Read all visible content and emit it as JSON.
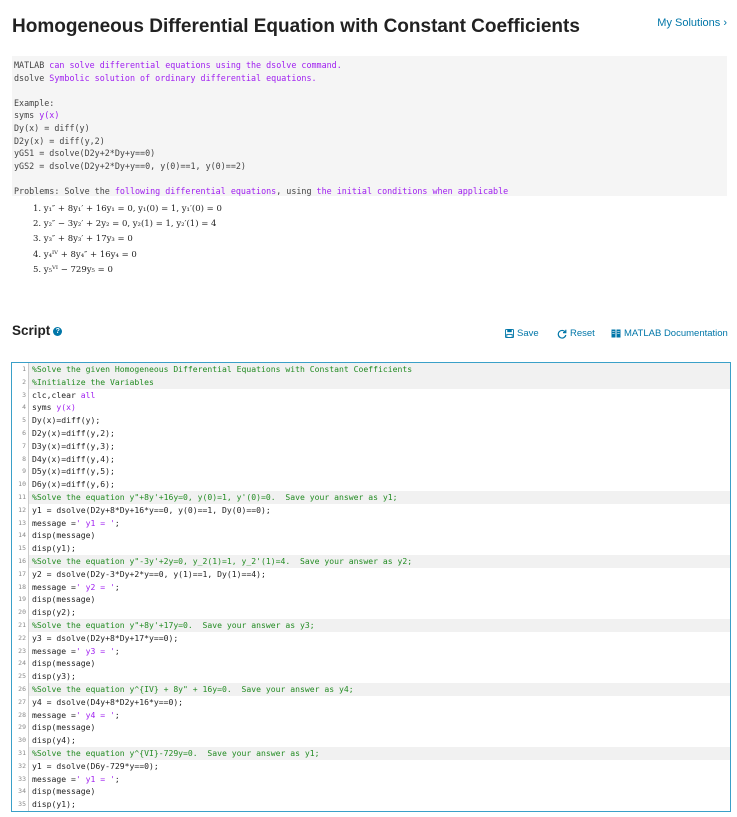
{
  "header": {
    "title": "Homogeneous Differential Equation with Constant Coefficients",
    "my_solutions": "My Solutions ›"
  },
  "description": {
    "lines": [
      [
        {
          "t": "MATLAB ",
          "c": ""
        },
        {
          "t": "can solve differential equations using the dsolve command.",
          "c": "purple"
        }
      ],
      [
        {
          "t": "dsolve ",
          "c": ""
        },
        {
          "t": "Symbolic solution of ordinary differential equations.",
          "c": "purple"
        }
      ],
      [],
      [
        {
          "t": "Example:",
          "c": ""
        }
      ],
      [
        {
          "t": "syms ",
          "c": ""
        },
        {
          "t": "y(x)",
          "c": "purple"
        }
      ],
      [
        {
          "t": "Dy(x) = diff(y)",
          "c": ""
        }
      ],
      [
        {
          "t": "D2y(x) = diff(y,2)",
          "c": ""
        }
      ],
      [
        {
          "t": "yGS1 = dsolve(D2y+2*Dy+y==0)",
          "c": ""
        }
      ],
      [
        {
          "t": "yGS2 = dsolve(D2y+2*Dy+y==0, y(0)==1, y(0)==2)",
          "c": ""
        }
      ],
      [],
      [
        {
          "t": "Problems: Solve the ",
          "c": ""
        },
        {
          "t": "following differential equations",
          "c": "purple"
        },
        {
          "t": ", using ",
          "c": ""
        },
        {
          "t": "the initial conditions when applicable",
          "c": "purple"
        }
      ]
    ]
  },
  "problems": [
    "1. y₁″ + 8y₁′ + 16y₁ = 0, y₁(0) = 1, y₁′(0) = 0",
    "2. y₂″ − 3y₂′ + 2y₂ = 0, y₂(1) = 1, y₂′(1) = 4",
    "3. y₃″ + 8y₃′ + 17y₃ = 0",
    "4. y₄ᴵⱽ + 8y₄″ + 16y₄ = 0",
    "5. y₅ⱽᴵ − 729y₅ = 0"
  ],
  "script": {
    "heading": "Script",
    "help": "?",
    "save_label": "Save",
    "reset_label": "Reset",
    "docs_label": "MATLAB Documentation"
  },
  "code_lines": [
    {
      "n": "1",
      "cm": true,
      "parts": [
        {
          "t": "%Solve the given Homogeneous Differential Equations with Constant Coefficients",
          "c": ""
        }
      ]
    },
    {
      "n": "2",
      "cm": true,
      "parts": [
        {
          "t": "%Initialize the Variables",
          "c": ""
        }
      ]
    },
    {
      "n": "3",
      "cm": false,
      "parts": [
        {
          "t": "clc,clear ",
          "c": ""
        },
        {
          "t": "all",
          "c": "str"
        }
      ]
    },
    {
      "n": "4",
      "cm": false,
      "parts": [
        {
          "t": "syms ",
          "c": ""
        },
        {
          "t": "y(x)",
          "c": "str"
        }
      ]
    },
    {
      "n": "5",
      "cm": false,
      "parts": [
        {
          "t": "Dy(x)=diff(y);",
          "c": ""
        }
      ]
    },
    {
      "n": "6",
      "cm": false,
      "parts": [
        {
          "t": "D2y(x)=diff(y,2);",
          "c": ""
        }
      ]
    },
    {
      "n": "7",
      "cm": false,
      "parts": [
        {
          "t": "D3y(x)=diff(y,3);",
          "c": ""
        }
      ]
    },
    {
      "n": "8",
      "cm": false,
      "parts": [
        {
          "t": "D4y(x)=diff(y,4);",
          "c": ""
        }
      ]
    },
    {
      "n": "9",
      "cm": false,
      "parts": [
        {
          "t": "D5y(x)=diff(y,5);",
          "c": ""
        }
      ]
    },
    {
      "n": "10",
      "cm": false,
      "parts": [
        {
          "t": "D6y(x)=diff(y,6);",
          "c": ""
        }
      ]
    },
    {
      "n": "11",
      "cm": true,
      "parts": [
        {
          "t": "%Solve the equation y\"+8y'+16y=0, y(0)=1, y'(0)=0.  Save your answer as y1;",
          "c": ""
        }
      ]
    },
    {
      "n": "12",
      "cm": false,
      "parts": [
        {
          "t": "y1 = dsolve(D2y+8*Dy+16*y==0, y(0)==1, Dy(0)==0);",
          "c": ""
        }
      ]
    },
    {
      "n": "13",
      "cm": false,
      "parts": [
        {
          "t": "message =",
          "c": ""
        },
        {
          "t": "' y1 = '",
          "c": "str"
        },
        {
          "t": ";",
          "c": ""
        }
      ]
    },
    {
      "n": "14",
      "cm": false,
      "parts": [
        {
          "t": "disp(message)",
          "c": ""
        }
      ]
    },
    {
      "n": "15",
      "cm": false,
      "parts": [
        {
          "t": "disp(y1);",
          "c": ""
        }
      ]
    },
    {
      "n": "16",
      "cm": true,
      "parts": [
        {
          "t": "%Solve the equation y\"-3y'+2y=0, y_2(1)=1, y_2'(1)=4.  Save your answer as y2;",
          "c": ""
        }
      ]
    },
    {
      "n": "17",
      "cm": false,
      "parts": [
        {
          "t": "y2 = dsolve(D2y-3*Dy+2*y==0, y(1)==1, Dy(1)==4);",
          "c": ""
        }
      ]
    },
    {
      "n": "18",
      "cm": false,
      "parts": [
        {
          "t": "message =",
          "c": ""
        },
        {
          "t": "' y2 = '",
          "c": "str"
        },
        {
          "t": ";",
          "c": ""
        }
      ]
    },
    {
      "n": "19",
      "cm": false,
      "parts": [
        {
          "t": "disp(message)",
          "c": ""
        }
      ]
    },
    {
      "n": "20",
      "cm": false,
      "parts": [
        {
          "t": "disp(y2);",
          "c": ""
        }
      ]
    },
    {
      "n": "21",
      "cm": true,
      "parts": [
        {
          "t": "%Solve the equation y\"+8y'+17y=0.  Save your answer as y3;",
          "c": ""
        }
      ]
    },
    {
      "n": "22",
      "cm": false,
      "parts": [
        {
          "t": "y3 = dsolve(D2y+8*Dy+17*y==0);",
          "c": ""
        }
      ]
    },
    {
      "n": "23",
      "cm": false,
      "parts": [
        {
          "t": "message =",
          "c": ""
        },
        {
          "t": "' y3 = '",
          "c": "str"
        },
        {
          "t": ";",
          "c": ""
        }
      ]
    },
    {
      "n": "24",
      "cm": false,
      "parts": [
        {
          "t": "disp(message)",
          "c": ""
        }
      ]
    },
    {
      "n": "25",
      "cm": false,
      "parts": [
        {
          "t": "disp(y3);",
          "c": ""
        }
      ]
    },
    {
      "n": "26",
      "cm": true,
      "parts": [
        {
          "t": "%Solve the equation y^{IV} + 8y\" + 16y=0.  Save your answer as y4;",
          "c": ""
        }
      ]
    },
    {
      "n": "27",
      "cm": false,
      "parts": [
        {
          "t": "y4 = dsolve(D4y+8*D2y+16*y==0);",
          "c": ""
        }
      ]
    },
    {
      "n": "28",
      "cm": false,
      "parts": [
        {
          "t": "message =",
          "c": ""
        },
        {
          "t": "' y4 = '",
          "c": "str"
        },
        {
          "t": ";",
          "c": ""
        }
      ]
    },
    {
      "n": "29",
      "cm": false,
      "parts": [
        {
          "t": "disp(message)",
          "c": ""
        }
      ]
    },
    {
      "n": "30",
      "cm": false,
      "parts": [
        {
          "t": "disp(y4);",
          "c": ""
        }
      ]
    },
    {
      "n": "31",
      "cm": true,
      "parts": [
        {
          "t": "%Solve the equation y^{VI}-729y=0.  Save your answer as y1;",
          "c": ""
        }
      ]
    },
    {
      "n": "32",
      "cm": false,
      "parts": [
        {
          "t": "y1 = dsolve(D6y-729*y==0);",
          "c": ""
        }
      ]
    },
    {
      "n": "33",
      "cm": false,
      "parts": [
        {
          "t": "message =",
          "c": ""
        },
        {
          "t": "' y1 = '",
          "c": "str"
        },
        {
          "t": ";",
          "c": ""
        }
      ]
    },
    {
      "n": "34",
      "cm": false,
      "parts": [
        {
          "t": "disp(message)",
          "c": ""
        }
      ]
    },
    {
      "n": "35",
      "cm": false,
      "parts": [
        {
          "t": "disp(y1);",
          "c": ""
        }
      ]
    }
  ]
}
